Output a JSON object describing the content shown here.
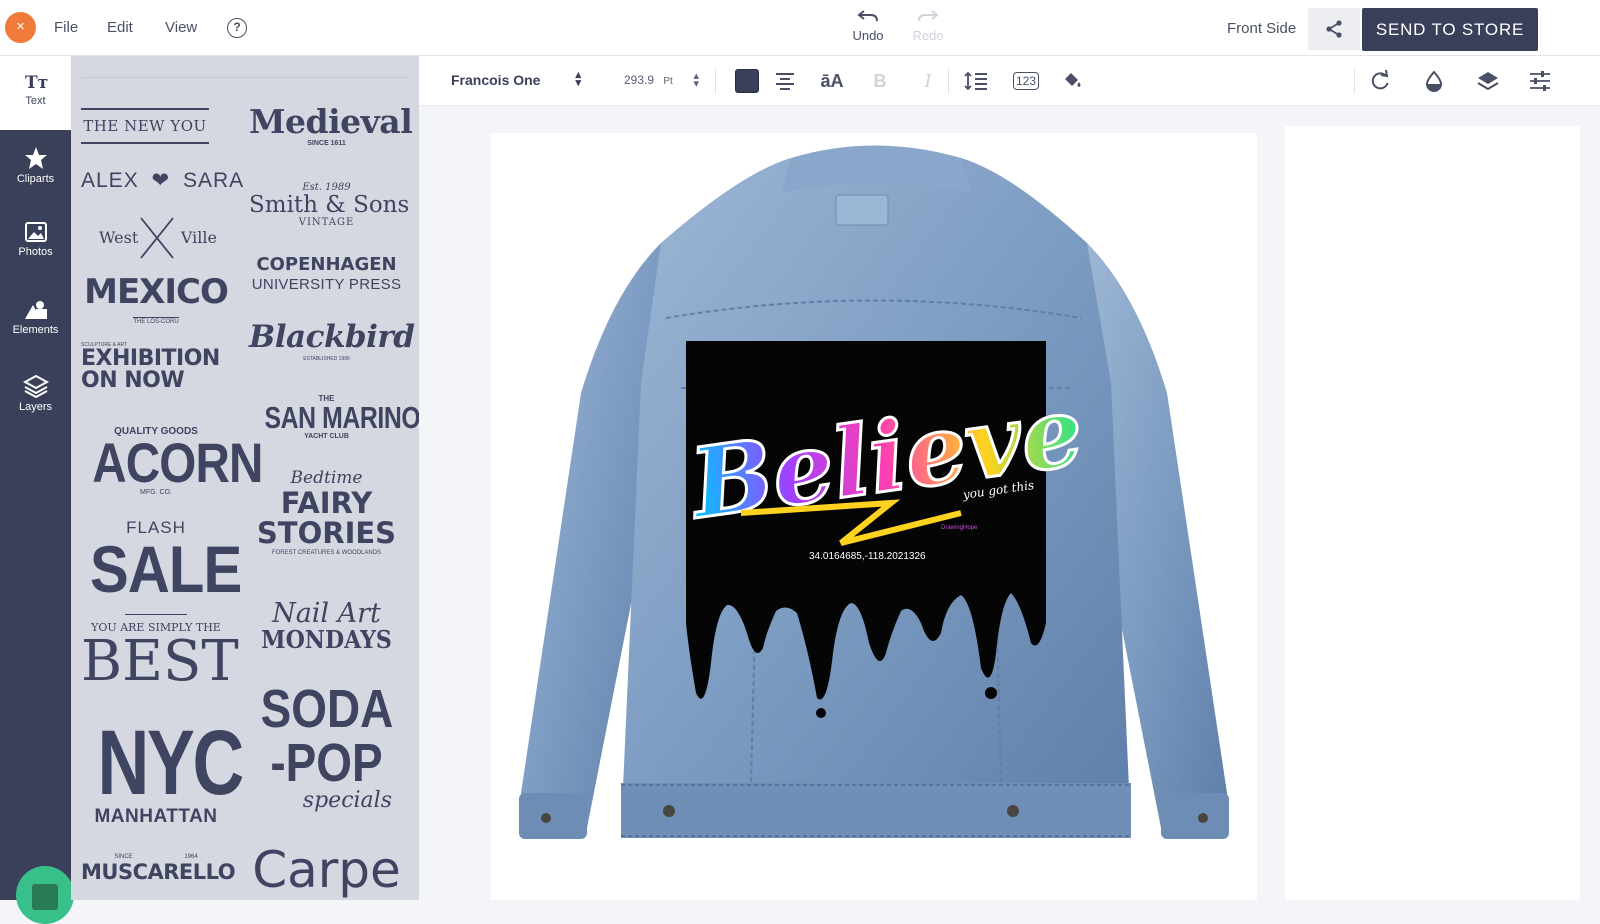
{
  "topbar": {
    "close_label": "×",
    "menus": [
      "File",
      "Edit",
      "View"
    ],
    "help_label": "?",
    "undo_label": "Undo",
    "redo_label": "Redo",
    "side_label": "Front Side",
    "send_label": "SEND TO STORE"
  },
  "rail": {
    "items": [
      {
        "label": "Text",
        "icon": "text-icon"
      },
      {
        "label": "Cliparts",
        "icon": "star-icon"
      },
      {
        "label": "Photos",
        "icon": "photo-icon"
      },
      {
        "label": "Elements",
        "icon": "shapes-icon"
      },
      {
        "label": "Layers",
        "icon": "layers-icon"
      }
    ]
  },
  "templates": {
    "new_you": "THE NEW YOU",
    "alex": "ALEX",
    "sara": "SARA",
    "west": "West",
    "ville": "Ville",
    "mexico": "MEXICO",
    "mexico_sub": "THE LOS-CORU",
    "exhibition_small": "SCULPTURE & ART",
    "exhibition_1": "EXHIBITION",
    "exhibition_2": "ON NOW",
    "quality": "QUALITY GOODS",
    "acorn": "ACORN",
    "acorn_sub": "MFG. CO.",
    "flash": "FLASH",
    "sale": "SALE",
    "simply": "YOU ARE SIMPLY THE",
    "best": "BEST",
    "nyc": "NYC",
    "manhattan": "MANHATTAN",
    "since_small": "SINCE",
    "year_small": "1964",
    "muscarello": "MUSCARELLO",
    "medieval": "Medieval",
    "medieval_sub": "SINCE 1611",
    "est": "Est. 1989",
    "smith": "Smith & Sons",
    "vintage": "VINTAGE",
    "copenhagen": "COPENHAGEN",
    "university": "UNIVERSITY PRESS",
    "blackbird": "Blackbird",
    "blackbird_sub": "ESTABLISHED 1996",
    "the": "THE",
    "san_marino": "SAN MARINO",
    "yacht": "YACHT CLUB",
    "bedtime": "Bedtime",
    "fairy": "FAIRY",
    "stories": "STORIES",
    "forest": "FOREST CREATURES & WOODLANDS",
    "nail_art": "Nail Art",
    "mondays": "MONDAYS",
    "soda": "SODA",
    "pop": "-POP",
    "specials": "specials",
    "carpe": "Carpe"
  },
  "toolbar": {
    "font": "Francois One",
    "size": "293.9",
    "unit": "Pt",
    "text_color": "#3a4059",
    "case_label": "āA",
    "bold_label": "B",
    "italic_label": "I",
    "numbers_label": "123"
  },
  "design": {
    "word": "Believe",
    "tagline": "you got this",
    "coords": "34.0164685,-118.2021326",
    "watermark": "DrawingHope"
  },
  "colors": {
    "accent": "#f07a3a",
    "navy": "#3a4059",
    "panel": "#d5d8e1",
    "denim": "#7d9cc2"
  }
}
